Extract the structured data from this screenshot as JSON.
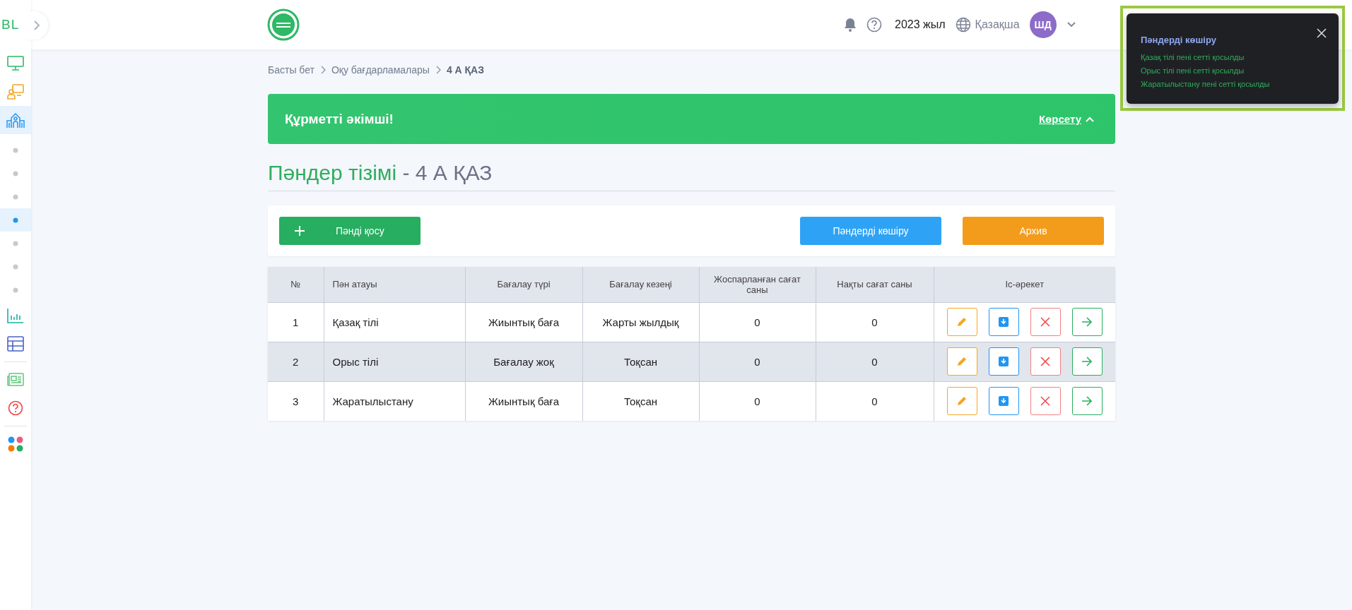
{
  "sidebar": {
    "logo": "BL",
    "groups": [
      [
        {
          "kind": "monitor",
          "selected": false
        },
        {
          "kind": "presentation",
          "selected": false
        },
        {
          "kind": "school",
          "selected": true
        },
        {
          "kind": "dot",
          "selected": false
        },
        {
          "kind": "dot",
          "selected": false
        },
        {
          "kind": "dot",
          "selected": false
        },
        {
          "kind": "dot",
          "selected": true
        },
        {
          "kind": "dot",
          "selected": false
        },
        {
          "kind": "dot",
          "selected": false
        },
        {
          "kind": "dot",
          "selected": false
        },
        {
          "kind": "chart",
          "selected": false
        },
        {
          "kind": "table",
          "selected": false
        }
      ],
      [
        {
          "kind": "news",
          "selected": false
        },
        {
          "kind": "help",
          "selected": false
        }
      ],
      [
        {
          "kind": "apps",
          "selected": false
        }
      ]
    ]
  },
  "header": {
    "year": "2023 жыл",
    "language": "Қазақша",
    "avatar": "ШД"
  },
  "breadcrumb": [
    {
      "label": "Басты бет",
      "current": false
    },
    {
      "label": "Оқу бағдарламалары",
      "current": false
    },
    {
      "label": "4 А ҚАЗ",
      "current": true
    }
  ],
  "banner": {
    "title": "Құрметті әкімші!",
    "toggle": "Көрсету",
    "expanded": true
  },
  "page_title": {
    "main": "Пәндер тізімі",
    "suffix": "- 4 А ҚАЗ"
  },
  "toolbar": {
    "add": "Пәнді қосу",
    "copy": "Пәндерді көшіру",
    "archive": "Архив"
  },
  "table": {
    "columns": [
      "№",
      "Пән атауы",
      "Бағалау түрі",
      "Бағалау кезеңі",
      "Жоспарланған сағат саны",
      "Нақты сағат саны",
      "Іс-әрекет"
    ],
    "rows": [
      {
        "selected": false,
        "cells": [
          "1",
          "Қазақ тілі",
          "Жиынтық баға",
          "Жарты жылдық",
          "0",
          "0"
        ]
      },
      {
        "selected": true,
        "cells": [
          "2",
          "Орыс тілі",
          "Бағалау жоқ",
          "Тоқсан",
          "0",
          "0"
        ]
      },
      {
        "selected": false,
        "cells": [
          "3",
          "Жаратылыстану",
          "Жиынтық баға",
          "Тоқсан",
          "0",
          "0"
        ]
      }
    ]
  },
  "toast": {
    "title": "Пәндерді көшіру",
    "messages": [
      "Қазақ тілі пені сетті қосылды",
      "Орыс тілі пені сетті қосылды",
      "Жаратылыстану пені сетті қосылды"
    ]
  }
}
